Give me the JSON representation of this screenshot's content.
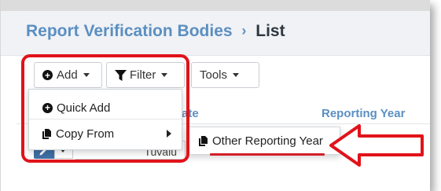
{
  "breadcrumb": {
    "parent": "Report Verification Bodies",
    "separator": "›",
    "current": "List"
  },
  "toolbar": {
    "add_label": "Add",
    "filter_label": "Filter",
    "tools_label": "Tools"
  },
  "table": {
    "columns": [
      {
        "label": "ate"
      },
      {
        "label": "Reporting Year"
      }
    ],
    "rows": [
      {
        "country": "Tuvalu"
      }
    ]
  },
  "add_menu": {
    "items": [
      {
        "label": "Quick Add",
        "icon": "plus-circle-icon"
      },
      {
        "label": "Copy From",
        "icon": "copy-file-icon",
        "has_submenu": true
      }
    ],
    "submenu": {
      "items": [
        {
          "label": "Other Reporting Year",
          "icon": "copy-file-icon"
        }
      ]
    }
  },
  "colors": {
    "accent": "#5b8fc1",
    "highlight": "#e1131a",
    "edit_button": "#3f6fa4"
  }
}
